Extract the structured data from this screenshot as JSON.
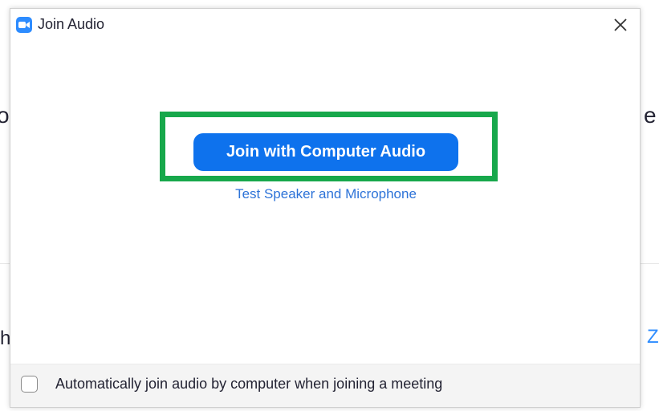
{
  "background": {
    "left_top_fragment": "o",
    "right_top_fragment": "e",
    "left_bottom_fragment": "h",
    "right_bottom_fragment": "Z"
  },
  "dialog": {
    "title": "Join Audio",
    "app_icon": "zoom-camera-icon",
    "close_icon": "close-icon",
    "join_button_label": "Join with Computer Audio",
    "test_link_label": "Test Speaker and Microphone",
    "highlight_color": "#17A84B",
    "button_color": "#0E72ED",
    "link_color": "#2D73D8"
  },
  "footer": {
    "checkbox_label": "Automatically join audio by computer when joining a meeting",
    "checkbox_checked": false
  }
}
